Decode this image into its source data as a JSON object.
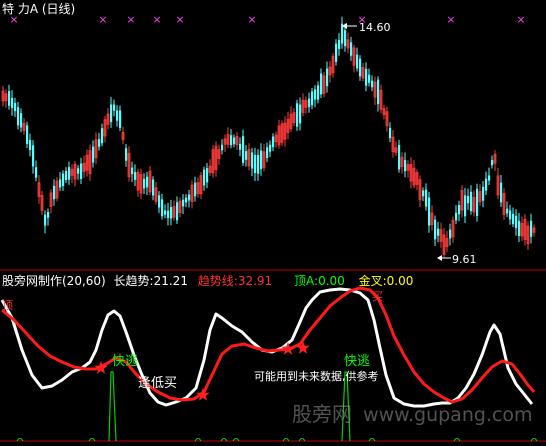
{
  "header": {
    "title_prefix": "特  力A",
    "period": "(日线)",
    "title_color": "#FFFFFF"
  },
  "price_panel": {
    "high_label": "14.60",
    "low_label": "9.61",
    "high_value": 14.6,
    "low_value": 9.61,
    "up_color": "#FF3B3B",
    "down_color": "#54FFFF",
    "marker_glyph": "×",
    "marker_color": "#FF40FF"
  },
  "indicator_panel": {
    "name": "股旁网制作(20,60)",
    "items": [
      {
        "label": "长趋势:",
        "value": "21.21",
        "color": "#FFFFFF"
      },
      {
        "label": "趋势线:",
        "value": "32.91",
        "color": "#FF3030"
      },
      {
        "label": "顶A:",
        "value": "0.00",
        "color": "#00FF00"
      },
      {
        "label": "金叉:",
        "value": "0.00",
        "color": "#FFFF00"
      }
    ],
    "signal_top": "顶",
    "signal_sell": "买",
    "signal_escape": "快逃",
    "signal_bottom_buy": "逢低买",
    "note": "可能用到未来数据,供参考",
    "long_trend_color": "#FFFFFF",
    "trend_line_color": "#FF1A1A",
    "spike_color": "#00D000",
    "star_color": "#FF2020"
  },
  "watermark": {
    "cn": "股旁网",
    "url": "www.gupang.com"
  }
}
